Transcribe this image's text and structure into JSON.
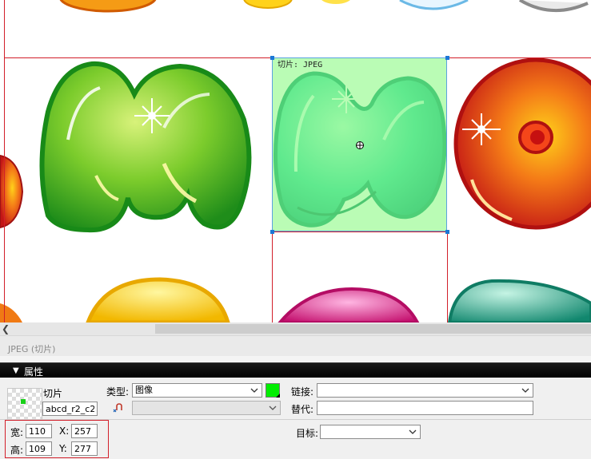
{
  "canvas": {
    "slice_label": "切片: JPEG"
  },
  "statusbar": {
    "text": "JPEG (切片)"
  },
  "props": {
    "panel_title": "属性",
    "slice_title": "切片",
    "slice_name": "abcd_r2_c2",
    "type_label": "类型:",
    "type_value": "图像",
    "link_label": "链接:",
    "link_value": "",
    "alt_label": "替代:",
    "alt_value": "",
    "target_label": "目标:",
    "target_value": "",
    "width_label": "宽:",
    "width_value": "110",
    "height_label": "高:",
    "height_value": "109",
    "x_label": "X:",
    "x_value": "257",
    "y_label": "Y:",
    "y_value": "277",
    "swatch_color": "#00ee00"
  },
  "colors": {
    "slice_guide": "#d21f2a",
    "selection_fill": "#82fa78",
    "selection_border": "#5aa2e0",
    "panel_header": "#000000"
  }
}
